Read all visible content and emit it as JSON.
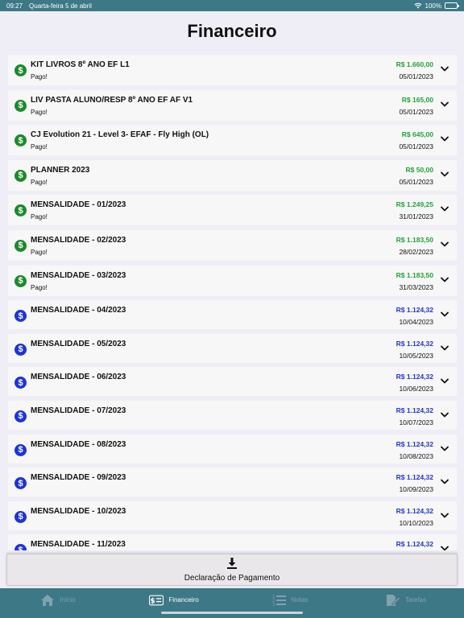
{
  "status_bar": {
    "time": "09:27",
    "date": "Quarta-feira 5 de abril",
    "battery": "100%"
  },
  "page": {
    "title": "Financeiro"
  },
  "colors": {
    "paid": "#22a23a",
    "open": "#2335d6",
    "tabbar": "#3d7887"
  },
  "items": [
    {
      "title": "KIT LIVROS 8º ANO EF L1",
      "status": "Pago!",
      "value": "R$ 1.660,00",
      "date": "05/01/2023",
      "paid": true
    },
    {
      "title": "LIV PASTA ALUNO/RESP 8º ANO EF AF V1",
      "status": "Pago!",
      "value": "R$ 165,00",
      "date": "05/01/2023",
      "paid": true
    },
    {
      "title": "CJ Evolution 21 - Level 3- EFAF - Fly High (OL)",
      "status": "Pago!",
      "value": "R$ 645,00",
      "date": "05/01/2023",
      "paid": true
    },
    {
      "title": "PLANNER 2023",
      "status": "Pago!",
      "value": "R$ 50,00",
      "date": "05/01/2023",
      "paid": true
    },
    {
      "title": "MENSALIDADE - 01/2023",
      "status": "Pago!",
      "value": "R$ 1.249,25",
      "date": "31/01/2023",
      "paid": true
    },
    {
      "title": "MENSALIDADE - 02/2023",
      "status": "Pago!",
      "value": "R$ 1.183,50",
      "date": "28/02/2023",
      "paid": true
    },
    {
      "title": "MENSALIDADE - 03/2023",
      "status": "Pago!",
      "value": "R$ 1.183,50",
      "date": "31/03/2023",
      "paid": true
    },
    {
      "title": "MENSALIDADE - 04/2023",
      "status": "",
      "value": "R$ 1.124,32",
      "date": "10/04/2023",
      "paid": false
    },
    {
      "title": "MENSALIDADE - 05/2023",
      "status": "",
      "value": "R$ 1.124,32",
      "date": "10/05/2023",
      "paid": false
    },
    {
      "title": "MENSALIDADE - 06/2023",
      "status": "",
      "value": "R$ 1.124,32",
      "date": "10/06/2023",
      "paid": false
    },
    {
      "title": "MENSALIDADE - 07/2023",
      "status": "",
      "value": "R$ 1.124,32",
      "date": "10/07/2023",
      "paid": false
    },
    {
      "title": "MENSALIDADE - 08/2023",
      "status": "",
      "value": "R$ 1.124,32",
      "date": "10/08/2023",
      "paid": false
    },
    {
      "title": "MENSALIDADE - 09/2023",
      "status": "",
      "value": "R$ 1.124,32",
      "date": "10/09/2023",
      "paid": false
    },
    {
      "title": "MENSALIDADE - 10/2023",
      "status": "",
      "value": "R$ 1.124,32",
      "date": "10/10/2023",
      "paid": false
    },
    {
      "title": "MENSALIDADE - 11/2023",
      "status": "",
      "value": "R$ 1.124,32",
      "date": "",
      "paid": false
    }
  ],
  "declaration": {
    "label": "Declaração de Pagamento"
  },
  "tabs": [
    {
      "label": "Início",
      "icon": "home-icon",
      "active": false
    },
    {
      "label": "Financeiro",
      "icon": "money-icon",
      "active": true
    },
    {
      "label": "Notas",
      "icon": "list-icon",
      "active": false
    },
    {
      "label": "Tarefas",
      "icon": "edit-icon",
      "active": false
    }
  ]
}
